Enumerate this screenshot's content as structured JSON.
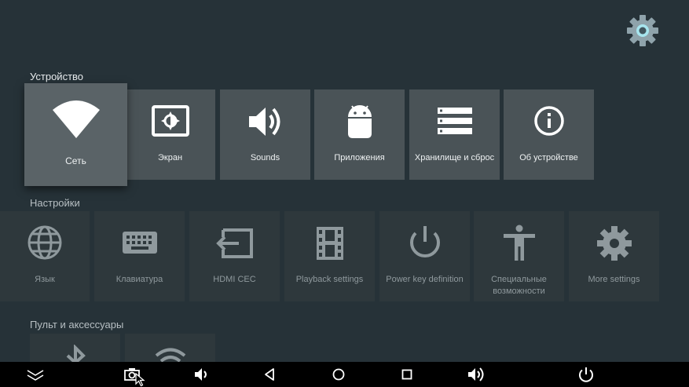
{
  "sections": {
    "device": {
      "title": "Устройство",
      "tiles": [
        {
          "label": "Сеть",
          "icon": "wifi-icon"
        },
        {
          "label": "Экран",
          "icon": "display-icon"
        },
        {
          "label": "Sounds",
          "icon": "volume-icon"
        },
        {
          "label": "Приложения",
          "icon": "android-icon"
        },
        {
          "label": "Хранилище и сброс",
          "icon": "storage-icon"
        },
        {
          "label": "Об устройстве",
          "icon": "info-icon"
        }
      ]
    },
    "settings": {
      "title": "Настройки",
      "tiles": [
        {
          "label": "Язык",
          "icon": "globe-icon"
        },
        {
          "label": "Клавиатура",
          "icon": "keyboard-icon"
        },
        {
          "label": "HDMI CEC",
          "icon": "input-icon"
        },
        {
          "label": "Playback settings",
          "icon": "film-icon"
        },
        {
          "label": "Power key definition",
          "icon": "power-icon"
        },
        {
          "label": "Специальные возможности",
          "icon": "accessibility-icon"
        },
        {
          "label": "More settings",
          "icon": "gear-icon"
        }
      ]
    },
    "remote": {
      "title": "Пульт и аксессуары",
      "tiles": [
        {
          "label": "",
          "icon": "bluetooth-icon"
        },
        {
          "label": "",
          "icon": "wifi-signal-icon"
        }
      ]
    }
  },
  "navbar": [
    "collapse-icon",
    "screenshot-icon",
    "volume-down-icon",
    "back-icon",
    "home-icon",
    "recents-icon",
    "volume-up-icon",
    "power-icon"
  ],
  "colors": {
    "background": "#263238",
    "tile": "#4a5357",
    "tile_focused": "#5a6367",
    "tile_dim": "#2e383c",
    "accent": "#a7e5ee"
  }
}
